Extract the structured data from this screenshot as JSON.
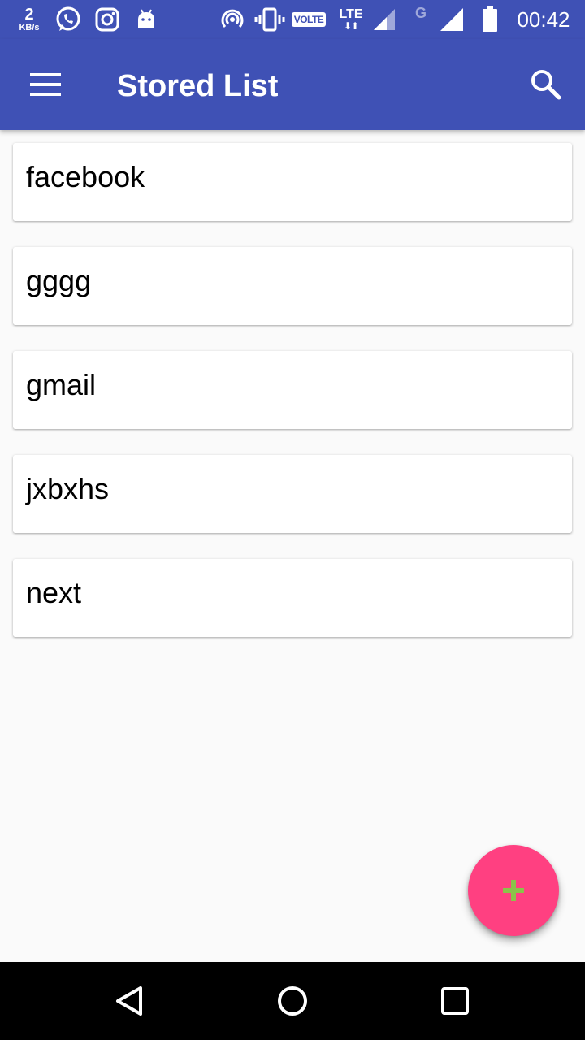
{
  "status_bar": {
    "net_speed_value": "2",
    "net_speed_unit": "KB/s",
    "icons": [
      "whatsapp-icon",
      "instagram-icon",
      "android-icon",
      "hotspot-icon",
      "vibrate-icon",
      "signal-icon",
      "battery-icon"
    ],
    "volte_label": "VOLTE",
    "lte_label": "LTE",
    "lte_arrows": "⬇⬆",
    "g_label": "G",
    "time": "00:42"
  },
  "app_bar": {
    "title": "Stored List",
    "menu_icon": "menu-icon",
    "search_icon": "search-icon"
  },
  "list": {
    "items": [
      {
        "label": "facebook"
      },
      {
        "label": "gggg"
      },
      {
        "label": "gmail"
      },
      {
        "label": "jxbxhs"
      },
      {
        "label": "next"
      }
    ]
  },
  "fab": {
    "icon": "plus-icon"
  },
  "nav_bar": {
    "icons": [
      "back-icon",
      "home-icon",
      "recents-icon"
    ]
  },
  "colors": {
    "primary": "#3f51b5",
    "accent": "#ff4081",
    "fab_plus": "#8bc34a",
    "background": "#fafafa"
  }
}
